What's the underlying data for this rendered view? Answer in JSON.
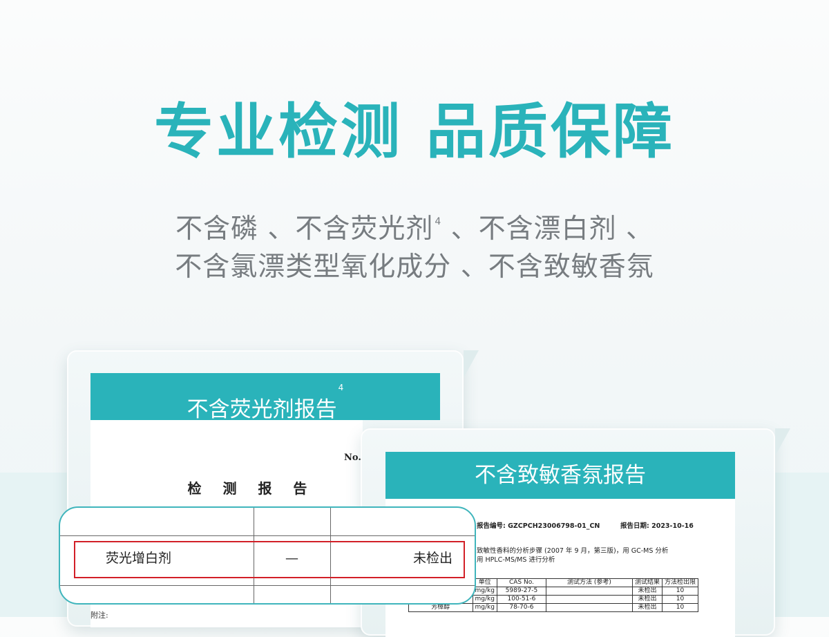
{
  "headline": "专业检测 品质保障",
  "subline1": {
    "text": "不含磷 、不含荧光剂",
    "note": "4",
    "text2": " 、不含漂白剂 、"
  },
  "subline2": "不含氯漂类型氧化成分 、不含致敏香氛",
  "report1": {
    "banner": "不含荧光剂报告",
    "banner_note": "4",
    "doc_no": "No.C",
    "doc_title": "检 测 报 告",
    "footer": "附注:",
    "zoom": {
      "item": "荧光增白剂",
      "dash": "—",
      "result": "未检出"
    }
  },
  "report2": {
    "banner": "不含致敏香氛报告",
    "report_no": "报告编号: GZCPCH23006798-01_CN",
    "report_date": "报告日期: 2023-10-16",
    "method_line1": "致敏性香料的分析步骤 (2007 年 9 月，第三版)，用 GC-MS 分析",
    "method_line2": "用 HPLC-MS/MS 进行分析",
    "table": {
      "headers": [
        "单位",
        "CAS No.",
        "测试方法 (参考)",
        "测试结果",
        "方法检出限"
      ],
      "rows": [
        {
          "name": "",
          "unit": "mg/kg",
          "cas": "5989-27-5",
          "method": "",
          "result": "未检出",
          "limit": "10"
        },
        {
          "name": "",
          "unit": "mg/kg",
          "cas": "100-51-6",
          "method": "",
          "result": "未检出",
          "limit": "10"
        },
        {
          "name": "芳樟醇",
          "unit": "mg/kg",
          "cas": "78-70-6",
          "method": "",
          "result": "未检出",
          "limit": "10"
        }
      ]
    }
  },
  "colors": {
    "accent": "#2ab3ba",
    "highlight": "#d21f27",
    "subtext": "#777c80"
  }
}
